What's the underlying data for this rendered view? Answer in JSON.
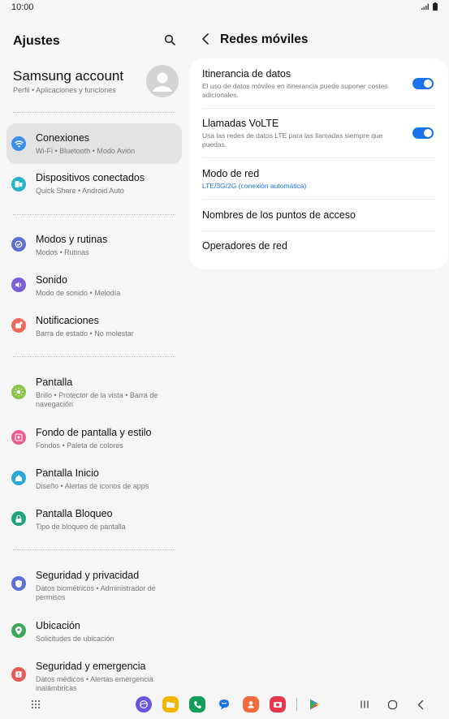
{
  "status_bar": {
    "time": "10:00"
  },
  "left": {
    "title": "Ajustes",
    "account": {
      "name": "Samsung account",
      "sub": "Perfil  •  Aplicaciones y funciones"
    },
    "items": [
      {
        "title": "Conexiones",
        "sub": "Wi-Fi  •  Bluetooth  •  Modo Avión",
        "icon": "wifi-icon",
        "color": "#3b8fe8"
      },
      {
        "title": "Dispositivos conectados",
        "sub": "Quick Share  •  Android Auto",
        "icon": "devices-icon",
        "color": "#27b5c8"
      },
      {
        "title": "Modos y rutinas",
        "sub": "Modos  •  Rutinas",
        "icon": "check-circle-icon",
        "color": "#5b6fd6"
      },
      {
        "title": "Sonido",
        "sub": "Modo de sonido  •  Melodía",
        "icon": "speaker-icon",
        "color": "#7b5fd6"
      },
      {
        "title": "Notificaciones",
        "sub": "Barra de estado  •  No molestar",
        "icon": "bell-icon",
        "color": "#f06a5c"
      },
      {
        "title": "Pantalla",
        "sub": "Brillo  •  Protector de la vista  •  Barra de navegación",
        "icon": "sun-icon",
        "color": "#8bc34a"
      },
      {
        "title": "Fondo de pantalla y estilo",
        "sub": "Fondos  •  Paleta de colores",
        "icon": "image-icon",
        "color": "#ec5c8e"
      },
      {
        "title": "Pantalla Inicio",
        "sub": "Diseño  •  Alertas de iconos de apps",
        "icon": "home-icon",
        "color": "#2aa8d8"
      },
      {
        "title": "Pantalla Bloqueo",
        "sub": "Tipo de bloqueo de pantalla",
        "icon": "lock-icon",
        "color": "#1fa57c"
      },
      {
        "title": "Seguridad y privacidad",
        "sub": "Datos biométricos  •  Administrador de permisos",
        "icon": "shield-icon",
        "color": "#5b6fd6"
      },
      {
        "title": "Ubicación",
        "sub": "Solicitudes de ubicación",
        "icon": "location-icon",
        "color": "#3aa858"
      },
      {
        "title": "Seguridad y emergencia",
        "sub": "Datos médicos  •  Alertas emergencia inalámbricas",
        "icon": "emergency-icon",
        "color": "#e85a5a"
      }
    ]
  },
  "right": {
    "title": "Redes móviles",
    "rows": [
      {
        "title": "Itinerancia de datos",
        "desc": "El uso de datos móviles en itinerancia puede suponer costes adicionales.",
        "toggle": true
      },
      {
        "title": "Llamadas VoLTE",
        "desc": "Usa las redes de datos LTE para las llamadas siempre que puedas.",
        "toggle": true
      },
      {
        "title": "Modo de red",
        "value": "LTE/3G/2G (conexión automática)"
      },
      {
        "title": "Nombres de los puntos de acceso"
      },
      {
        "title": "Operadores de red"
      }
    ]
  },
  "colors": {
    "accent": "#1a73e8",
    "selected_bg": "#e3e3e3",
    "background": "#f6f6f6",
    "card": "#ffffff"
  }
}
